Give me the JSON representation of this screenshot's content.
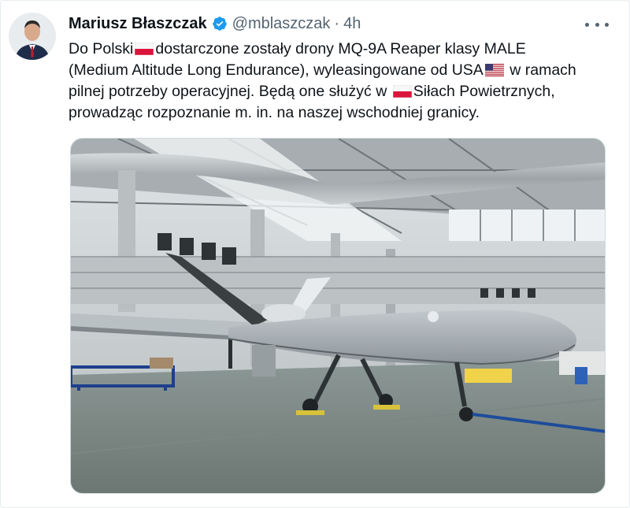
{
  "author": {
    "name": "Mariusz Błaszczak",
    "handle": "@mblaszczak",
    "separator": "·",
    "time": "4h"
  },
  "tweet": {
    "line1_a": "Do Polski",
    "line1_b": "dostarczone zostały drony MQ-9A Reaper klasy MALE",
    "line2_a": "(Medium Altitude Long Endurance), wyleasingowane od USA",
    "line2_b": "w ramach",
    "line3_a": "pilnej potrzeby operacyjnej. Będą one służyć w",
    "line3_b": "Siłach Powietrznych,",
    "line4": "prowadząc rozpoznanie m. in. na naszej wschodniej granicy."
  },
  "icons": {
    "verified": "verified-badge-icon",
    "more": "more-options-icon",
    "flag_pl": "poland-flag-icon",
    "flag_us": "usa-flag-icon"
  },
  "colors": {
    "verified_blue": "#1d9bf0",
    "secondary_text": "#536471",
    "primary_text": "#0f1419",
    "poland_red": "#dc143c"
  }
}
